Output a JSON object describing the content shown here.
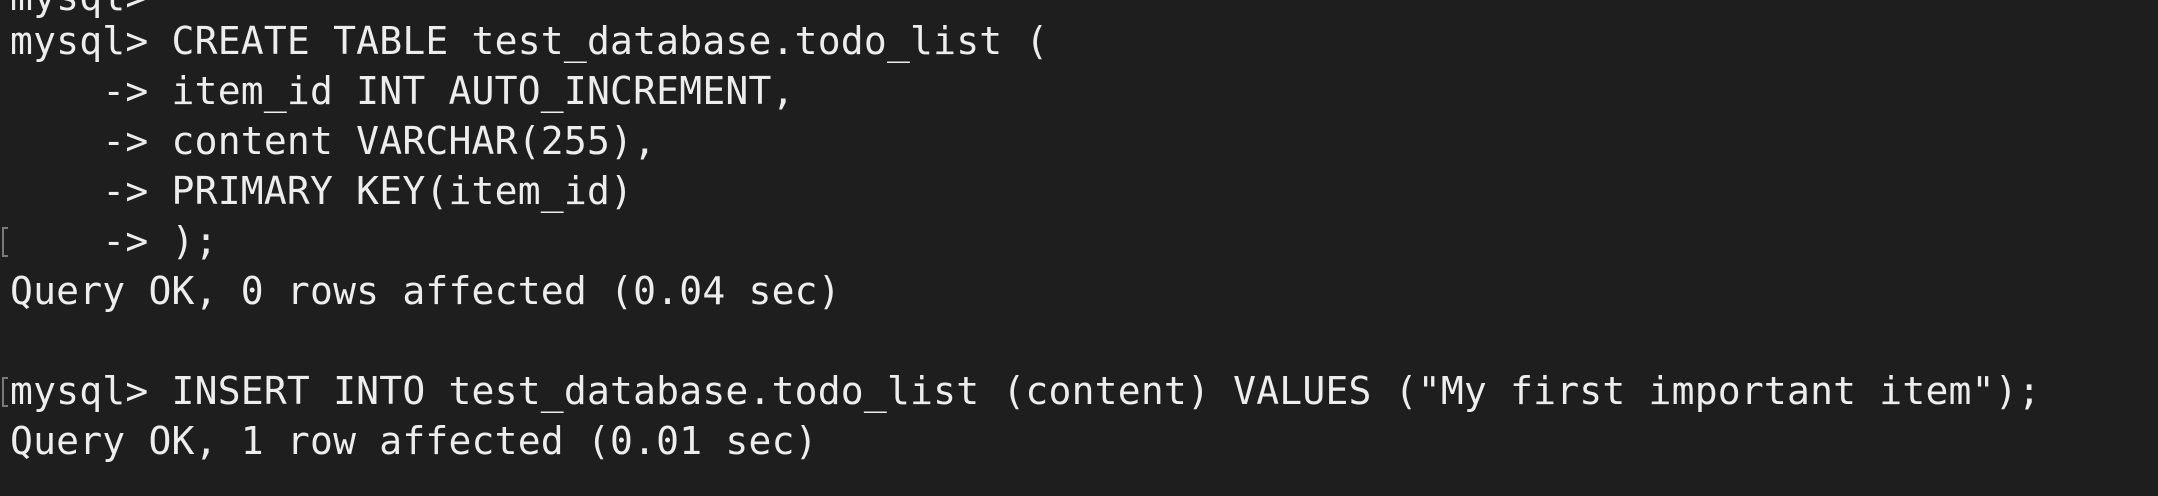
{
  "terminal": {
    "lines": [
      "mysql>",
      "mysql> CREATE TABLE test_database.todo_list (",
      "    -> item_id INT AUTO_INCREMENT,",
      "    -> content VARCHAR(255),",
      "    -> PRIMARY KEY(item_id)",
      "    -> );",
      "Query OK, 0 rows affected (0.04 sec)",
      "",
      "mysql> INSERT INTO test_database.todo_list (content) VALUES (\"My first important item\");",
      "Query OK, 1 row affected (0.01 sec)"
    ]
  },
  "colors": {
    "background": "#1e1e1e",
    "text": "#ededed"
  }
}
